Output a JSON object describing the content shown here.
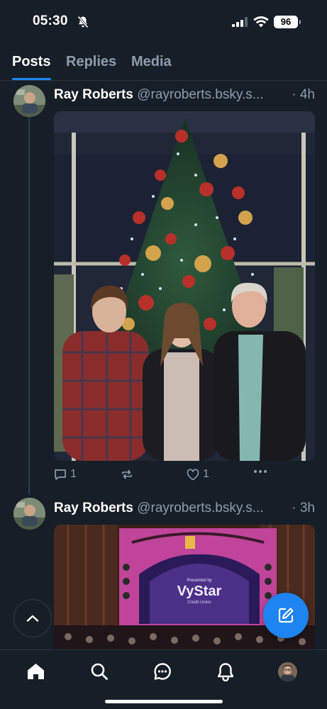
{
  "status_bar": {
    "time": "05:30",
    "battery": "96"
  },
  "tabs": [
    {
      "label": "Posts",
      "active": true
    },
    {
      "label": "Replies",
      "active": false
    },
    {
      "label": "Media",
      "active": false
    }
  ],
  "posts": [
    {
      "author": "Ray Roberts",
      "handle": "@rayroberts.bsky.s...",
      "time": "· 4h",
      "image_desc": "photo-family-christmas-tree",
      "reply_count": "1",
      "like_count": "1"
    },
    {
      "author": "Ray Roberts",
      "handle": "@rayroberts.bsky.s...",
      "time": "· 3h",
      "image_desc": "photo-theater-stage",
      "stage_sign_top": "Presented by",
      "stage_sign_brand": "VyStar",
      "stage_sign_sub": "Credit Union"
    }
  ],
  "colors": {
    "background": "#161e27",
    "accent": "#1d84f1",
    "muted_text": "#8e9dac"
  },
  "icons": {
    "nav": [
      "home-icon",
      "search-icon",
      "chat-icon",
      "bell-icon",
      "profile-avatar"
    ]
  }
}
